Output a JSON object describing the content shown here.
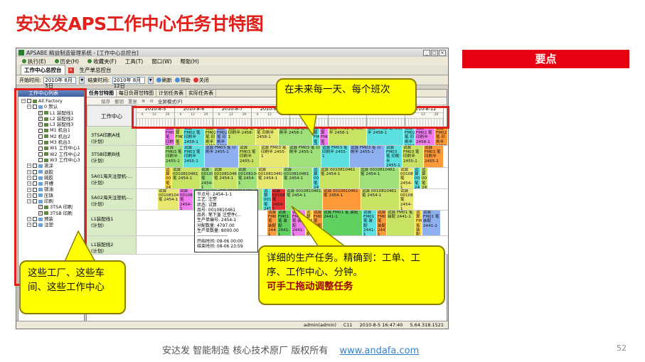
{
  "slide": {
    "title": "安达发APS工作中心任务甘特图",
    "keypoint": "要点",
    "footer_text": "安达发  智能制造 核心技术原厂  版权所有",
    "footer_link": "www.andafa.com",
    "page_number": "52"
  },
  "app": {
    "window_title": "APSABE 精益制造管理系统 - [工作中心总控台]",
    "window_buttons": [
      "_",
      "□",
      "×"
    ],
    "menu": [
      "执行(E)",
      "历史(H)",
      "收藏夹(F)",
      "工具(T)",
      "窗口(W)",
      "帮助(H)"
    ],
    "tabs": [
      {
        "label": "工作中心总控台"
      },
      {
        "label": "生产单总控台"
      }
    ],
    "toolbar": {
      "start_label": "开始时间:",
      "start_value": "2010年 8月 5日",
      "end_label": "结束时间:",
      "end_value": "2010年 8月12日",
      "refresh": "刷新",
      "help": "帮助",
      "close": "关闭"
    },
    "left_panel": {
      "header": "工作中心列表",
      "tree": [
        {
          "label": "All Factory",
          "level": 0
        },
        {
          "label": "0 默认",
          "level": 1
        },
        {
          "label": "L1 装配线1",
          "level": 2,
          "checked": true
        },
        {
          "label": "L2 装配线2",
          "level": 2,
          "checked": true
        },
        {
          "label": "L3 装配线3",
          "level": 2,
          "checked": true
        },
        {
          "label": "M1 机台1",
          "level": 2
        },
        {
          "label": "M2 机台2",
          "level": 2
        },
        {
          "label": "M3 机台3",
          "level": 2
        },
        {
          "label": "W1 工作中心1",
          "level": 2
        },
        {
          "label": "W2 工作中心2",
          "level": 2
        },
        {
          "label": "W3 工作中心3",
          "level": 2
        },
        {
          "label": "滚涂",
          "level": 1
        },
        {
          "label": "退胶",
          "level": 1
        },
        {
          "label": "硫胶",
          "level": 1
        },
        {
          "label": "开槽",
          "level": 1
        },
        {
          "label": "锁油",
          "level": 1
        },
        {
          "label": "压铸",
          "level": 1
        },
        {
          "label": "印刷",
          "level": 1
        },
        {
          "label": "3TSA 印刷",
          "level": 2,
          "checked": true
        },
        {
          "label": "3TSB 印刷",
          "level": 2,
          "checked": true
        },
        {
          "label": "预装",
          "level": 1
        },
        {
          "label": "注塑",
          "level": 1
        }
      ]
    },
    "sub_tabs": [
      "任务甘特图",
      "每日负荷甘特图",
      "计划任务表",
      "实际任务表"
    ],
    "sub_toolbar": [
      "保存",
      "撤销",
      "重复",
      "全屏模式(F)"
    ],
    "gantt": {
      "header_label": "工作中心",
      "days": [
        "2010-8-5",
        "2010-8-6",
        "2010-8-7",
        "2010-8-8",
        "2010-8-9",
        "2010-8-10",
        "2010-8-11",
        "2010-8-12"
      ],
      "hours": [
        "4",
        "12",
        "20"
      ],
      "rows": [
        {
          "name": "3TSA印刷A线",
          "sub": "(计划)"
        },
        {
          "name": "3TSB印刷B线",
          "sub": "(计划)"
        },
        {
          "name": "5A01海天注塑机-…",
          "sub": "(计划)"
        },
        {
          "name": "5A02海天注塑机-…",
          "sub": "(计划)"
        },
        {
          "name": "L1装配线1",
          "sub": "(计划)"
        },
        {
          "name": "L1装配线2",
          "sub": "(计划)"
        }
      ],
      "task_text": {
        "a": "试算 FM02 笔 印刷半 2458-1",
        "b": "试算 FM03 笔 印刷半 2455-1",
        "c": "试算 0010810461 笔 2454-1",
        "d": "试算 FM01 笔 装配 2441-1"
      }
    },
    "popup": {
      "lines": [
        "节点号: 2454-1-1",
        "工艺: 注塑",
        "状态: 试算",
        "品号: 0010810461",
        "品名: 笔下盖 注塑件(...",
        "生产单编号: 2454-1",
        "分配数量: 4797.00",
        "生产单数量: 8000.00",
        "--------------------",
        "开始时间: 08-06 00:00",
        "结束时间: 08-06 23:59"
      ]
    },
    "status": {
      "user": "admin(admin)",
      "code": "C11",
      "datetime": "2010-8-5 16:47:40",
      "version": "5.64.318.1521"
    }
  },
  "callouts": {
    "top": "在未来每一天、每个班次",
    "left": "这些工厂、这些车间、这些工作中心",
    "bottom_line1": "详细的生产任务。精确到：工单、工序、工作中心、分钟。",
    "bottom_line2": "可手工拖动调整任务"
  },
  "colors": {
    "accent": "#e0201a",
    "callout": "#ffff00",
    "task_colors": [
      "#f07cf0",
      "#c8e264",
      "#5de0e0",
      "#ffd84a",
      "#9fe07a",
      "#e8e870",
      "#ff9a3a",
      "#e03030",
      "#60d060",
      "#8fb0f0"
    ]
  }
}
